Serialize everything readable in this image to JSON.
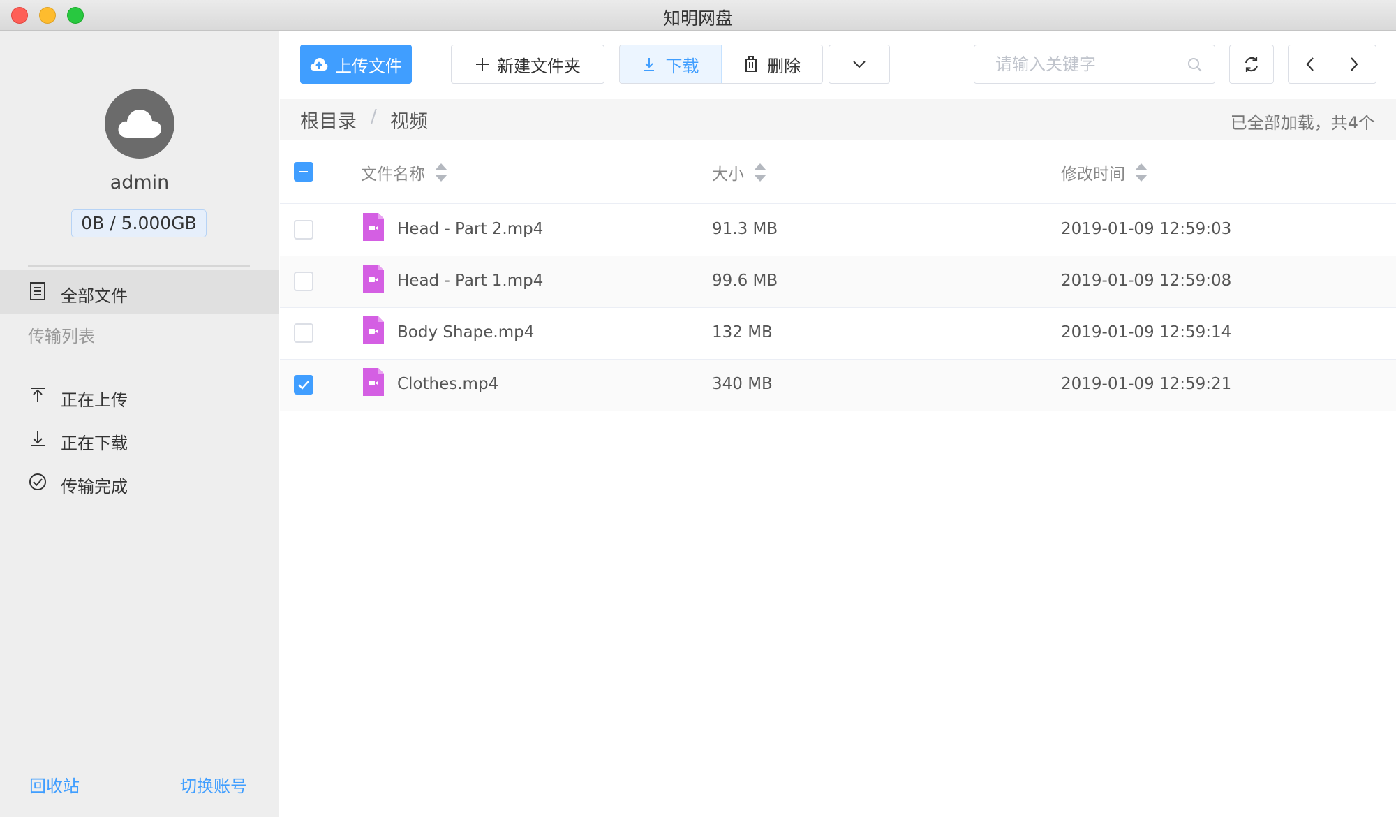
{
  "window": {
    "title": "知明网盘"
  },
  "sidebar": {
    "username": "admin",
    "quota": "0B / 5.000GB",
    "nav_all_files": "全部文件",
    "section_transfer": "传输列表",
    "nav_uploading": "正在上传",
    "nav_downloading": "正在下载",
    "nav_done": "传输完成",
    "recycle": "回收站",
    "switch_account": "切换账号"
  },
  "toolbar": {
    "upload_label": "上传文件",
    "new_folder_label": "新建文件夹",
    "download_label": "下载",
    "delete_label": "删除",
    "search_placeholder": "请输入关键字"
  },
  "breadcrumb": {
    "root": "根目录",
    "current": "视频"
  },
  "status": {
    "loaded_text": "已全部加载，共4个"
  },
  "table": {
    "headers": {
      "name": "文件名称",
      "size": "大小",
      "modified": "修改时间"
    },
    "rows": [
      {
        "name": "Head - Part 2.mp4",
        "size": "91.3 MB",
        "modified": "2019-01-09 12:59:03",
        "checked": false
      },
      {
        "name": "Head - Part 1.mp4",
        "size": "99.6 MB",
        "modified": "2019-01-09 12:59:08",
        "checked": false
      },
      {
        "name": "Body Shape.mp4",
        "size": "132 MB",
        "modified": "2019-01-09 12:59:14",
        "checked": false
      },
      {
        "name": "Clothes.mp4",
        "size": "340 MB",
        "modified": "2019-01-09 12:59:21",
        "checked": true
      }
    ]
  },
  "colors": {
    "accent": "#409eff",
    "file_icon": "#d45fe3",
    "sidebar_bg": "#eeeeee"
  },
  "icons": [
    "cloud-icon",
    "document-list-icon",
    "upload-icon",
    "download-icon",
    "check-circle-icon",
    "cloud-upload-icon",
    "plus-icon",
    "trash-icon",
    "chevron-down-icon",
    "search-icon",
    "refresh-icon",
    "chevron-left-icon",
    "chevron-right-icon",
    "video-file-icon"
  ]
}
